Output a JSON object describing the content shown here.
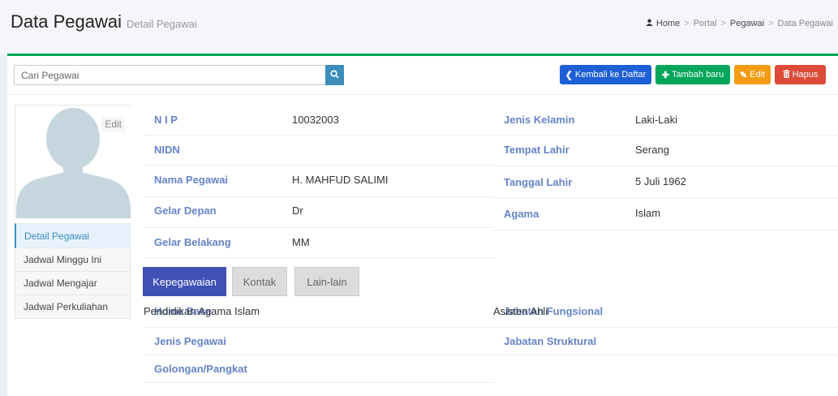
{
  "header": {
    "title": "Data Pegawai",
    "subtitle": "Detail Pegawai",
    "breadcrumb": [
      "Home",
      "Portal",
      "Pegawai",
      "Data Pegawai"
    ]
  },
  "toolbar": {
    "search_placeholder": "Cari Pegawai",
    "back_label": "Kembali ke Daftar",
    "add_label": "Tambah baru",
    "edit_label": "Edit",
    "delete_label": "Hapus"
  },
  "profile": {
    "edit_label": "Edit"
  },
  "side_menu": [
    "Detail Pegawai",
    "Jadwal Minggu Ini",
    "Jadwal Mengajar",
    "Jadwal Perkuliahan"
  ],
  "details_left": [
    {
      "label": "N I P",
      "value": "10032003"
    },
    {
      "label": "NIDN",
      "value": ""
    },
    {
      "label": "Nama Pegawai",
      "value": "H. MAHFUD SALIMI"
    },
    {
      "label": "Gelar Depan",
      "value": "Dr"
    },
    {
      "label": "Gelar Belakang",
      "value": "MM"
    }
  ],
  "details_right": [
    {
      "label": "Jenis Kelamin",
      "value": "Laki-Laki"
    },
    {
      "label": "Tempat Lahir",
      "value": "Serang"
    },
    {
      "label": "Tanggal Lahir",
      "value": "5 Juli 1962"
    },
    {
      "label": "Agama",
      "value": "Islam"
    }
  ],
  "tabs": [
    "Kepegawaian",
    "Kontak",
    "Lain-lain"
  ],
  "employment_left": [
    {
      "label": "Home Base",
      "value": "Pendidikan Agama Islam"
    },
    {
      "label": "Jenis Pegawai",
      "value": ""
    },
    {
      "label": "Golongan/Pangkat",
      "value": ""
    }
  ],
  "employment_right": [
    {
      "label": "Jabatan Fungsional",
      "value": "Asisten Ahli"
    },
    {
      "label": "Jabatan Struktural",
      "value": ""
    }
  ],
  "colors": {
    "primary": "#3c8dbc",
    "success": "#00a65a",
    "warning": "#f39c12",
    "danger": "#dd4b39",
    "tab_active": "#3f51b5",
    "label": "#6583c7"
  }
}
